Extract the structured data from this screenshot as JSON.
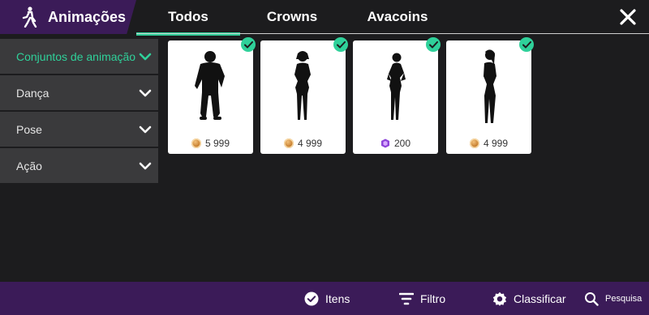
{
  "header": {
    "title": "Animações",
    "tabs": [
      {
        "label": "Todos",
        "active": true
      },
      {
        "label": "Crowns",
        "active": false
      },
      {
        "label": "Avacoins",
        "active": false
      }
    ]
  },
  "sidebar": {
    "items": [
      {
        "label": "Conjuntos de animação",
        "active": true
      },
      {
        "label": "Dança",
        "active": false
      },
      {
        "label": "Pose",
        "active": false
      },
      {
        "label": "Ação",
        "active": false
      }
    ]
  },
  "cards": [
    {
      "price": "5 999",
      "currency": "crown-coin-icon",
      "owned": true
    },
    {
      "price": "4 999",
      "currency": "crown-coin-icon",
      "owned": true
    },
    {
      "price": "200",
      "currency": "avacoin-icon",
      "owned": true
    },
    {
      "price": "4 999",
      "currency": "crown-coin-icon",
      "owned": true
    }
  ],
  "bottom_bar": {
    "items_label": "Itens",
    "filter_label": "Filtro",
    "sort_label": "Classificar",
    "search_label": "Pesquisa"
  },
  "colors": {
    "accent": "#2fd19a",
    "brand_purple": "#3b1b58",
    "background": "#1c1c1e",
    "sidebar_item": "#3a3a3c"
  }
}
